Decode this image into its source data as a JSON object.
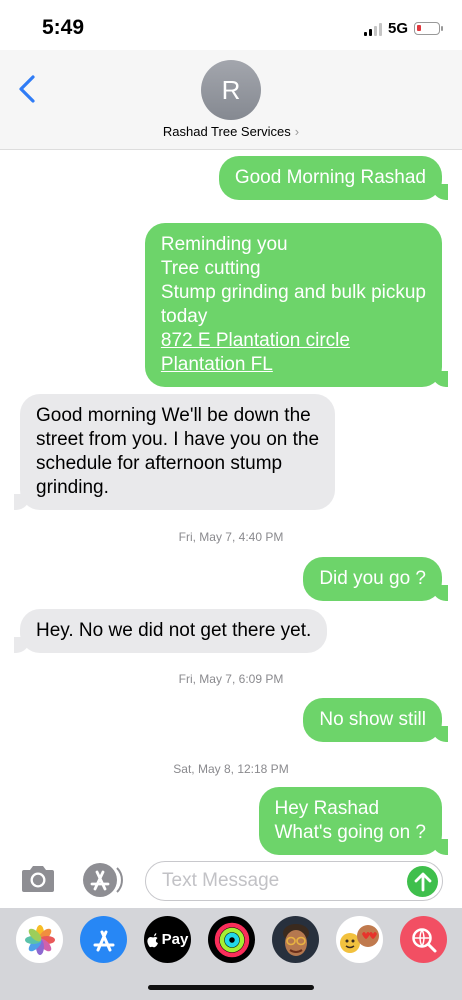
{
  "status_bar": {
    "time": "5:49",
    "network": "5G"
  },
  "header": {
    "avatar_initial": "R",
    "contact_name": "Rashad Tree Services",
    "chevron": "›"
  },
  "messages": {
    "m1": {
      "lines": [
        "Good Morning Rashad"
      ]
    },
    "m2": {
      "lines": [
        "Reminding you",
        "Tree cutting",
        "Stump grinding and bulk pickup",
        "today"
      ],
      "links": [
        "872 E Plantation circle",
        "Plantation FL"
      ]
    },
    "m3": {
      "lines": [
        "Good morning We'll be down the",
        "street from you. I have you on the",
        "schedule for afternoon stump",
        "grinding."
      ]
    },
    "t1": "Fri, May 7, 4:40 PM",
    "m4": {
      "lines": [
        "Did you go ?"
      ]
    },
    "m5": {
      "lines": [
        "Hey. No we did not get there yet."
      ]
    },
    "t2": "Fri, May 7, 6:09 PM",
    "m6": {
      "lines": [
        "No show still"
      ]
    },
    "t3": "Sat, May 8, 12:18 PM",
    "m7": {
      "lines": [
        "Hey Rashad",
        "What's going on ?"
      ]
    }
  },
  "input": {
    "placeholder": "Text Message"
  },
  "tray": {
    "apple_pay_label": "Pay"
  },
  "colors": {
    "sent_bubble": "#6dd46a",
    "received_bubble": "#e9e9eb",
    "send_button": "#3fbf4c",
    "back_chevron": "#2f7cf6"
  },
  "icons": [
    "camera-icon",
    "app-store-icon",
    "send-arrow-icon",
    "photos-icon",
    "app-store-tray-icon",
    "apple-pay-icon",
    "activity-icon",
    "memoji-icon",
    "memoji-stickers-icon",
    "web-search-icon"
  ]
}
